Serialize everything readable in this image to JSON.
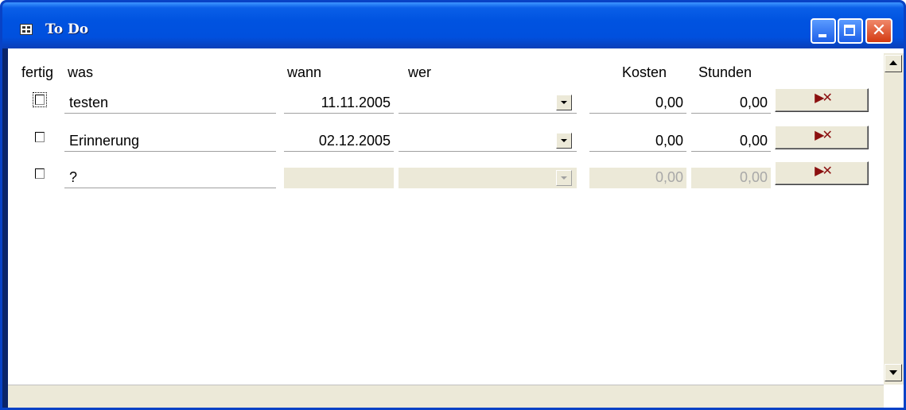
{
  "window": {
    "title": "To Do",
    "close_glyph": "✕"
  },
  "columns": {
    "fertig": "fertig",
    "was": "was",
    "wann": "wann",
    "wer": "wer",
    "kosten": "Kosten",
    "stunden": "Stunden"
  },
  "rows": [
    {
      "done": false,
      "was": "testen",
      "wann": "11.11.2005",
      "wer": "",
      "kosten": "0,00",
      "stunden": "0,00",
      "delete_glyph": "▶✕"
    },
    {
      "done": false,
      "was": "Erinnerung",
      "wann": "02.12.2005",
      "wer": "",
      "kosten": "0,00",
      "stunden": "0,00",
      "delete_glyph": "▶✕"
    },
    {
      "done": false,
      "was": "?",
      "wann": "",
      "wer": "",
      "kosten": "0,00",
      "stunden": "0,00",
      "delete_glyph": "▶✕"
    }
  ],
  "icons": {
    "window": "form-icon",
    "delete": "delete-record-icon",
    "dropdown": "chevron-down-icon"
  },
  "colors": {
    "titlebar": "#0053e0",
    "face": "#ece9d8",
    "delete_icon": "#8b1010"
  }
}
